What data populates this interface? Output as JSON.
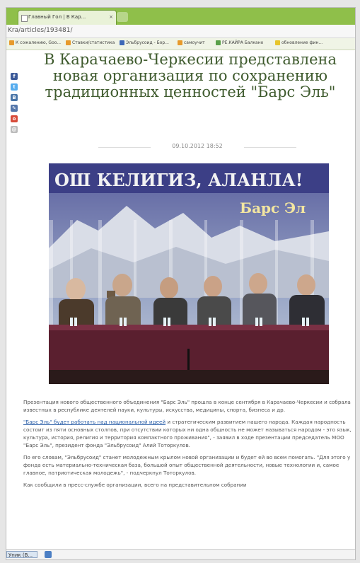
{
  "browser": {
    "tab_title": "Главный Гол | В Кар...",
    "tab_close": "×",
    "address": "Kra/articles/193481/",
    "bookmarks": [
      "К сожалению, Goo...",
      "Ставки/статистика",
      "Эльбрусоид - Бор...",
      "самоучит",
      "РЕ.КАЙРА Балкано",
      "обновление фин..."
    ]
  },
  "article": {
    "headline": "В Карачаево-Черкесии представлена новая организация по сохранению традиционных ценностей \"Барс Эль\"",
    "date": "09.10.2012 18:52",
    "photo": {
      "banner_text": "ОШ КЕЛИГИЗ, АЛАНЛА!",
      "banner_sub": "Барс Эл"
    },
    "paragraphs": [
      "Презентация нового общественного объединения \"Барс Эль\" прошла в конце сентября в Карачаево-Черкесии и собрала известных в республике деятелей науки, культуры, искусства, медицины, спорта, бизнеса и др."
    ],
    "p2_link": "\"Барс Эль\" будет работать над национальной идеей",
    "p2_rest": " и стратегическим развитием нашего народа. Каждая народность состоит из пяти основных столпов, при отсутствии которых ни одна общность не может называться народом - это язык, культура, история, религия и территория компактного проживания\", - заявил в ходе презентации председатель МОО \"Барс Эль\", президент фонда \"Эльбрусоид\" Алий Тоторкулов.",
    "p3": "По его словам, \"Эльбрусоид\" станет молодежным крылом новой организации и будет ей во всем помогать. \"Для этого у фонда есть материально-техническая база, большой опыт общественной деятельности, новые технологии и, самое главное, патриотическая молодежь\", - подчеркнул Тоторкулов.",
    "p4": "Как сообщили в пресс-службе организации, всего на представительном собрании"
  },
  "statusbar": {
    "task_label": "Уник (В..."
  },
  "colors": {
    "headline": "#3f5b2e",
    "tabbar": "#8fbf4a",
    "link": "#2b5fa8"
  }
}
